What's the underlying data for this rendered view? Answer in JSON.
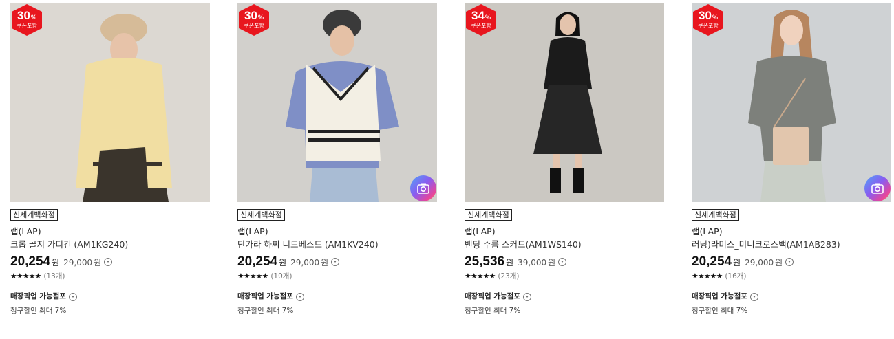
{
  "products": [
    {
      "discount_pct": "30",
      "pct_symbol": "%",
      "coupon_label": "쿠폰포함",
      "store_tag": "신세계백화점",
      "brand": "랩(LAP)",
      "name": "크롭 골지 가디건 (AM1KG240)",
      "price": "20,254",
      "currency": "원",
      "original_price": "29,000",
      "stars": "★★★★★",
      "review_count": "(13개)",
      "pickup_label": "매장픽업 가능점포",
      "billing_discount": "청구할인 최대 7%",
      "has_camera_icon": false,
      "photo": {
        "bg": "#dcd8d2",
        "top": "#f1dea2",
        "bottom": "#3a342c",
        "accent": "#f1dea2",
        "hat": "#d6bb98"
      }
    },
    {
      "discount_pct": "30",
      "pct_symbol": "%",
      "coupon_label": "쿠폰포함",
      "store_tag": "신세계백화점",
      "brand": "랩(LAP)",
      "name": "단가라 하찌 니트베스트 (AM1KV240)",
      "price": "20,254",
      "currency": "원",
      "original_price": "29,000",
      "stars": "★★★★★",
      "review_count": "(10개)",
      "pickup_label": "매장픽업 가능점포",
      "billing_discount": "청구할인 최대 7%",
      "has_camera_icon": true,
      "photo": {
        "bg": "#d2d0cc",
        "top": "#f3efe4",
        "bottom": "#a9bcd4",
        "accent": "#7f8fc6",
        "hat": "#3a3a3a"
      }
    },
    {
      "discount_pct": "34",
      "pct_symbol": "%",
      "coupon_label": "쿠폰포함",
      "store_tag": "신세계백화점",
      "brand": "랩(LAP)",
      "name": "밴딩 주름 스커트(AM1WS140)",
      "price": "25,536",
      "currency": "원",
      "original_price": "39,000",
      "stars": "★★★★★",
      "review_count": "(23개)",
      "pickup_label": "매장픽업 가능점포",
      "billing_discount": "청구할인 최대 7%",
      "has_camera_icon": false,
      "photo": {
        "bg": "#cbc8c2",
        "top": "#1b1b1b",
        "bottom": "#262626",
        "accent": "#1b1b1b",
        "hat": "#111111"
      }
    },
    {
      "discount_pct": "30",
      "pct_symbol": "%",
      "coupon_label": "쿠폰포함",
      "store_tag": "신세계백화점",
      "brand": "랩(LAP)",
      "name": "러닝)라미스_미니크로스백(AM1AB283)",
      "price": "20,254",
      "currency": "원",
      "original_price": "29,000",
      "stars": "★★★★★",
      "review_count": "(16개)",
      "pickup_label": "매장픽업 가능점포",
      "billing_discount": "청구할인 최대 7%",
      "has_camera_icon": true,
      "photo": {
        "bg": "#cfd2d4",
        "top": "#7d807b",
        "bottom": "#c9cfc7",
        "accent": "#e2c6ad",
        "hat": "#b7865f"
      }
    }
  ],
  "icons": {
    "badge": "hexagon-discount-badge-icon",
    "camera": "camera-review-icon",
    "info": "chevron-down-circle-icon"
  },
  "colors": {
    "badge_red": "#e8161e"
  }
}
